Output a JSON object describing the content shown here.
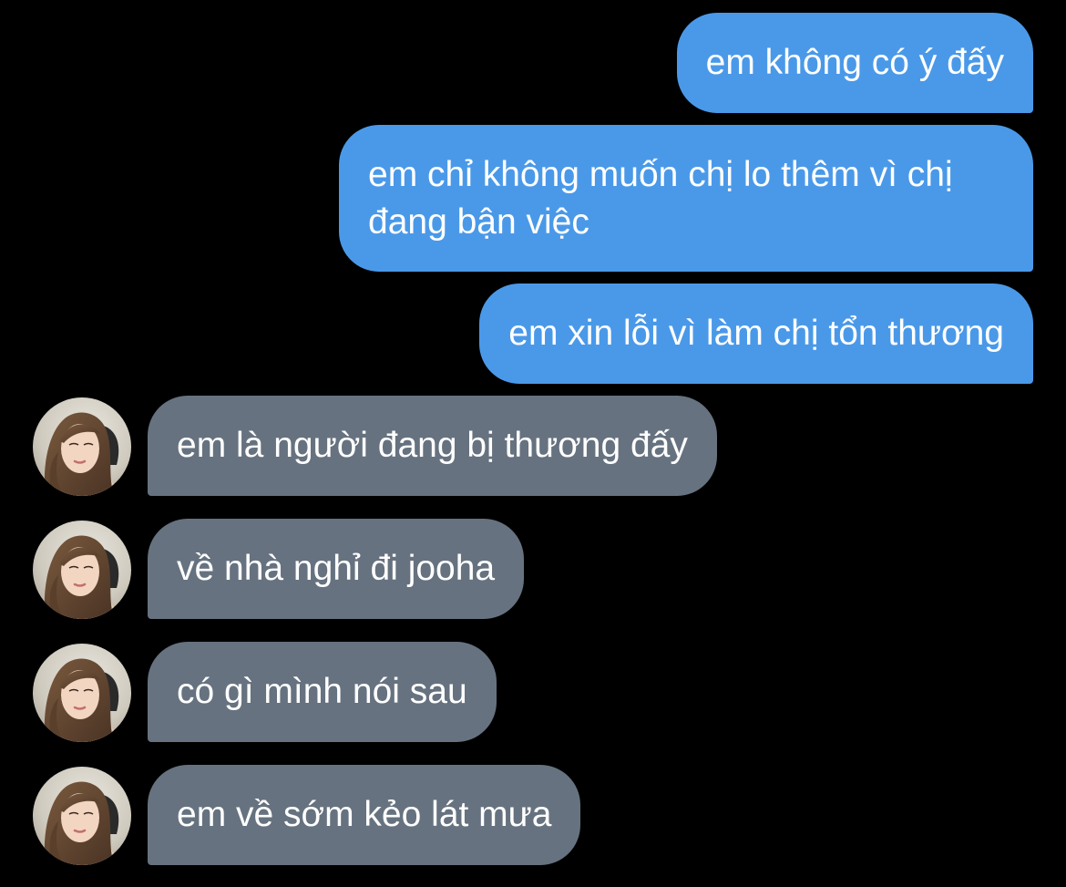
{
  "conversation": {
    "contact_avatar_icon": "contact-photo-icon",
    "colors": {
      "background": "#000000",
      "sent_bubble": "#4a99e9",
      "received_bubble": "#66727f",
      "text": "#ffffff"
    },
    "messages": [
      {
        "sender": "me",
        "text": "em không có ý đấy"
      },
      {
        "sender": "me",
        "text": "em chỉ không muốn chị lo thêm vì chị đang bận việc"
      },
      {
        "sender": "me",
        "text": "em xin lỗi vì làm chị tổn thương"
      },
      {
        "sender": "contact",
        "text": "em là người đang bị thương đấy"
      },
      {
        "sender": "contact",
        "text": "về nhà nghỉ đi jooha"
      },
      {
        "sender": "contact",
        "text": "có gì mình nói sau"
      },
      {
        "sender": "contact",
        "text": "em về sớm kẻo lát mưa"
      }
    ]
  }
}
